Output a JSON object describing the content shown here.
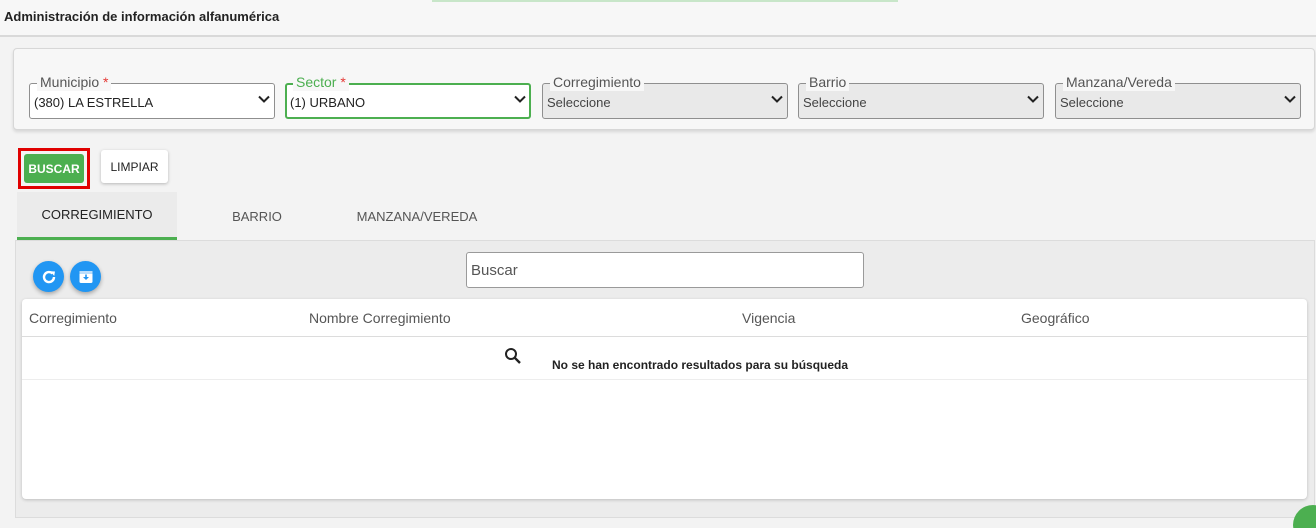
{
  "page": {
    "title": "Administración de información alfanumérica"
  },
  "filters": {
    "municipio": {
      "label": "Municipio",
      "required_mark": "*",
      "value": "(380) LA ESTRELLA"
    },
    "sector": {
      "label": "Sector",
      "required_mark": "*",
      "value": "(1) URBANO"
    },
    "corregimiento": {
      "label": "Corregimiento",
      "value": "Seleccione"
    },
    "barrio": {
      "label": "Barrio",
      "value": "Seleccione"
    },
    "manzana": {
      "label": "Manzana/Vereda",
      "value": "Seleccione"
    }
  },
  "actions": {
    "buscar": "BUSCAR",
    "limpiar": "LIMPIAR"
  },
  "tabs": [
    {
      "label": "CORREGIMIENTO",
      "active": true
    },
    {
      "label": "BARRIO",
      "active": false
    },
    {
      "label": "MANZANA/VEREDA",
      "active": false
    }
  ],
  "toolbar": {
    "search_placeholder": "Buscar",
    "refresh_icon": "refresh-icon",
    "export_icon": "download-icon"
  },
  "table": {
    "columns": [
      "Corregimiento",
      "Nombre Corregimiento",
      "Vigencia",
      "Geográfico"
    ],
    "rows": [],
    "empty_message": "No se han encontrado resultados para su búsqueda"
  },
  "colors": {
    "accent": "#4caf50",
    "primary": "#2196f3",
    "highlight": "#e00000"
  }
}
